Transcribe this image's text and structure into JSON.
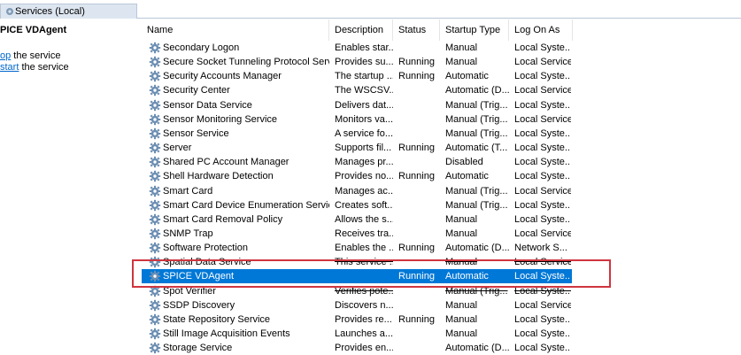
{
  "window": {
    "tab_title": "Services (Local)"
  },
  "left_pane": {
    "service_title": "PICE VDAgent",
    "actions": [
      {
        "link": "op",
        "rest": " the service"
      },
      {
        "link": "start",
        "rest": " the service"
      }
    ]
  },
  "columns": [
    "Name",
    "Description",
    "Status",
    "Startup Type",
    "Log On As"
  ],
  "sort_indicator": "^",
  "services": [
    {
      "name": "Secondary Logon",
      "description": "Enables star...",
      "status": "",
      "startup": "Manual",
      "logon": "Local Syste..."
    },
    {
      "name": "Secure Socket Tunneling Protocol Service",
      "description": "Provides su...",
      "status": "Running",
      "startup": "Manual",
      "logon": "Local Service"
    },
    {
      "name": "Security Accounts Manager",
      "description": "The startup ...",
      "status": "Running",
      "startup": "Automatic",
      "logon": "Local Syste..."
    },
    {
      "name": "Security Center",
      "description": "The WSCSV...",
      "status": "",
      "startup": "Automatic (D...",
      "logon": "Local Service"
    },
    {
      "name": "Sensor Data Service",
      "description": "Delivers dat...",
      "status": "",
      "startup": "Manual (Trig...",
      "logon": "Local Syste..."
    },
    {
      "name": "Sensor Monitoring Service",
      "description": "Monitors va...",
      "status": "",
      "startup": "Manual (Trig...",
      "logon": "Local Service"
    },
    {
      "name": "Sensor Service",
      "description": "A service fo...",
      "status": "",
      "startup": "Manual (Trig...",
      "logon": "Local Syste..."
    },
    {
      "name": "Server",
      "description": "Supports fil...",
      "status": "Running",
      "startup": "Automatic (T...",
      "logon": "Local Syste..."
    },
    {
      "name": "Shared PC Account Manager",
      "description": "Manages pr...",
      "status": "",
      "startup": "Disabled",
      "logon": "Local Syste..."
    },
    {
      "name": "Shell Hardware Detection",
      "description": "Provides no...",
      "status": "Running",
      "startup": "Automatic",
      "logon": "Local Syste..."
    },
    {
      "name": "Smart Card",
      "description": "Manages ac...",
      "status": "",
      "startup": "Manual (Trig...",
      "logon": "Local Service"
    },
    {
      "name": "Smart Card Device Enumeration Service",
      "description": "Creates soft...",
      "status": "",
      "startup": "Manual (Trig...",
      "logon": "Local Syste..."
    },
    {
      "name": "Smart Card Removal Policy",
      "description": "Allows the s...",
      "status": "",
      "startup": "Manual",
      "logon": "Local Syste..."
    },
    {
      "name": "SNMP Trap",
      "description": "Receives tra...",
      "status": "",
      "startup": "Manual",
      "logon": "Local Service"
    },
    {
      "name": "Software Protection",
      "description": "Enables the ...",
      "status": "Running",
      "startup": "Automatic (D...",
      "logon": "Network S..."
    },
    {
      "name": "Spatial Data Service",
      "description": "This service ...",
      "status": "",
      "startup": "Manual",
      "logon": "Local Service",
      "struck": true
    },
    {
      "name": "SPICE VDAgent",
      "description": "",
      "status": "Running",
      "startup": "Automatic",
      "logon": "Local Syste...",
      "selected": true
    },
    {
      "name": "Spot Verifier",
      "description": "Verifies pote...",
      "status": "",
      "startup": "Manual (Trig...",
      "logon": "Local Syste...",
      "struck": true
    },
    {
      "name": "SSDP Discovery",
      "description": "Discovers n...",
      "status": "",
      "startup": "Manual",
      "logon": "Local Service"
    },
    {
      "name": "State Repository Service",
      "description": "Provides re...",
      "status": "Running",
      "startup": "Manual",
      "logon": "Local Syste..."
    },
    {
      "name": "Still Image Acquisition Events",
      "description": "Launches a...",
      "status": "",
      "startup": "Manual",
      "logon": "Local Syste..."
    },
    {
      "name": "Storage Service",
      "description": "Provides en...",
      "status": "",
      "startup": "Automatic (D...",
      "logon": "Local Syste..."
    }
  ],
  "colors": {
    "selection": "#0078d7",
    "highlight_box": "#d0353f",
    "link": "#0066cc"
  },
  "icons": {
    "service": "gear-icon",
    "tab": "services-icon"
  }
}
